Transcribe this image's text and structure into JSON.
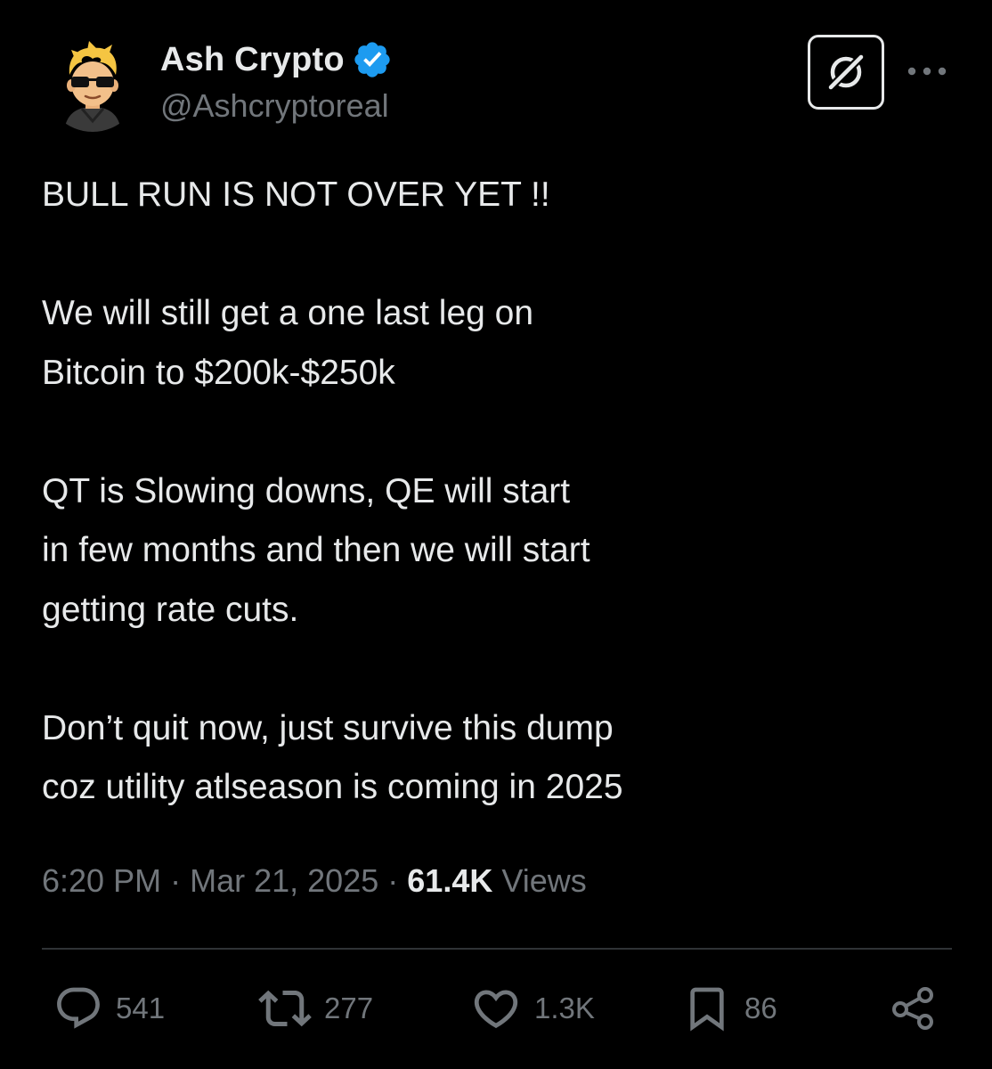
{
  "tweet": {
    "author": {
      "display_name": "Ash Crypto",
      "handle": "@Ashcryptoreal",
      "verified_icon": "verified-badge-icon"
    },
    "paragraphs": [
      "BULL RUN IS NOT OVER YET !!",
      "We will still get a one last leg on\nBitcoin to $200k-$250k",
      "QT is Slowing downs, QE will start\nin few months and then we will start\ngetting rate cuts.",
      "Don’t quit now, just survive this dump\ncoz utility atlseason is coming in 2025"
    ],
    "time": "6:20 PM",
    "separator": "·",
    "date": "Mar 21, 2025",
    "views_count": "61.4K",
    "views_label": "Views"
  },
  "actions": {
    "replies": "541",
    "reposts": "277",
    "likes": "1.3K",
    "bookmarks": "86"
  },
  "icons": {
    "grok": "grok-icon",
    "more": "more-dots-icon",
    "reply": "reply-icon",
    "repost": "repost-icon",
    "like": "heart-icon",
    "bookmark": "bookmark-icon",
    "share": "share-icon"
  },
  "colors": {
    "background": "#000000",
    "text_primary": "#e7e9ea",
    "text_secondary": "#71767b",
    "verified_blue": "#1d9bf0",
    "divider": "#2f3336"
  }
}
